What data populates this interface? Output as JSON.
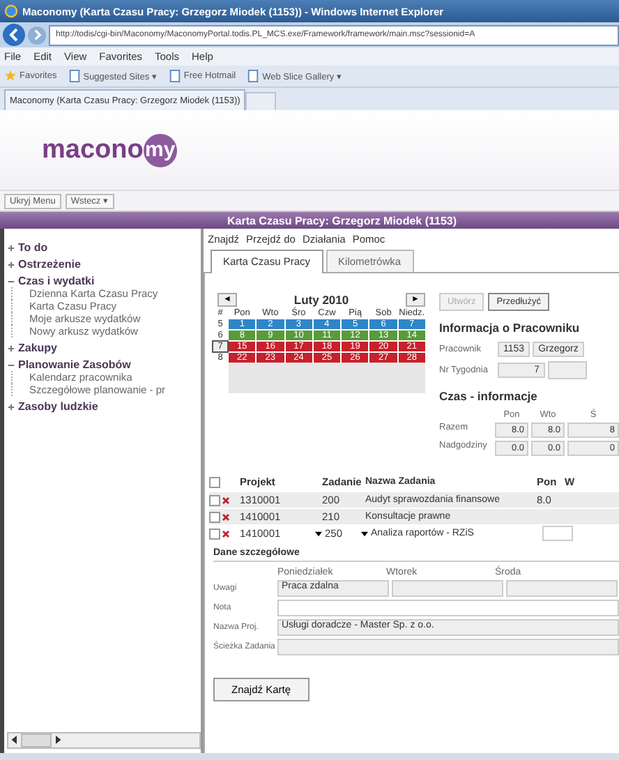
{
  "browser": {
    "title": "Maconomy (Karta Czasu Pracy: Grzegorz Miodek (1153)) - Windows Internet Explorer",
    "address": "http://todis/cgi-bin/Maconomy/MaconomyPortal.todis.PL_MCS.exe/Framework/framework/main.msc?sessionid=A",
    "menu": [
      "File",
      "Edit",
      "View",
      "Favorites",
      "Tools",
      "Help"
    ],
    "favorites": [
      {
        "label": "Favorites",
        "kind": "star"
      },
      {
        "label": "Suggested Sites ▾",
        "kind": "page"
      },
      {
        "label": "Free Hotmail",
        "kind": "page"
      },
      {
        "label": "Web Slice Gallery ▾",
        "kind": "page"
      }
    ],
    "tab": "Maconomy (Karta Czasu Pracy: Grzegorz Miodek (1153))"
  },
  "app": {
    "logo_text": "macono",
    "logo_badge": "my",
    "toolbar": [
      "Ukryj Menu",
      "Wstecz ▾"
    ]
  },
  "sidebar": {
    "items": [
      {
        "label": "To do",
        "expanded": false
      },
      {
        "label": "Ostrzeżenie",
        "expanded": false
      },
      {
        "label": "Czas i wydatki",
        "expanded": true,
        "children": [
          "Dzienna Karta Czasu Pracy",
          "Karta Czasu Pracy",
          "Moje arkusze wydatków",
          "Nowy arkusz wydatków"
        ]
      },
      {
        "label": "Zakupy",
        "expanded": false
      },
      {
        "label": "Planowanie Zasobów",
        "expanded": true,
        "children": [
          "Kalendarz pracownika",
          "Szczegółowe planowanie - pr"
        ]
      },
      {
        "label": "Zasoby ludzkie",
        "expanded": false
      }
    ]
  },
  "panel": {
    "title": "Karta Czasu Pracy: Grzegorz Miodek (1153)",
    "menu": [
      "Znajdź",
      "Przejdź do",
      "Działania",
      "Pomoc"
    ],
    "tabs": [
      {
        "label": "Karta Czasu Pracy",
        "selected": true
      },
      {
        "label": "Kilometrówka",
        "selected": false
      }
    ],
    "calendar": {
      "prev": "◄",
      "next": "►",
      "month": "Luty 2010",
      "headers": [
        "#",
        "Pon",
        "Wto",
        "Śro",
        "Czw",
        "Pią",
        "Sob",
        "Niedz."
      ],
      "weeks": [
        {
          "number": "5",
          "selected": false,
          "color": "#2e86c9",
          "days": [
            "1",
            "2",
            "3",
            "4",
            "5",
            "6",
            "7"
          ]
        },
        {
          "number": "6",
          "selected": false,
          "color": "#5a9a3a",
          "days": [
            "8",
            "9",
            "10",
            "11",
            "12",
            "13",
            "14"
          ]
        },
        {
          "number": "7",
          "selected": true,
          "color": "#c8202c",
          "days": [
            "15",
            "16",
            "17",
            "18",
            "19",
            "20",
            "21"
          ]
        },
        {
          "number": "8",
          "selected": false,
          "color": "#c8202c",
          "days": [
            "22",
            "23",
            "24",
            "25",
            "26",
            "27",
            "28"
          ]
        }
      ]
    },
    "actions": [
      {
        "label": "Utwórz",
        "disabled": true
      },
      {
        "label": "Przedłużyć",
        "disabled": false
      }
    ],
    "employee": {
      "title": "Informacja o Pracowniku",
      "employee_label": "Pracownik",
      "employee_id": "1153",
      "employee_name": "Grzegorz",
      "week_label": "Nr Tygodnia",
      "week_value": "7"
    },
    "time": {
      "title": "Czas - informacje",
      "columns": [
        "Pon",
        "Wto",
        "Ś"
      ],
      "rows": [
        {
          "label": "Razem",
          "values": [
            "8.0",
            "8.0",
            "8"
          ]
        },
        {
          "label": "Nadgodziny",
          "values": [
            "0.0",
            "0.0",
            "0"
          ]
        }
      ]
    },
    "table": {
      "all_checked": false,
      "columns": [
        "Projekt",
        "Zadanie",
        "Nazwa Zadania",
        "Pon",
        "W"
      ],
      "rows": [
        {
          "project": "1310001",
          "task": "200",
          "name": "Audyt sprawozdania finansowe",
          "pon": "8.0",
          "editing": false,
          "checked": false
        },
        {
          "project": "1410001",
          "task": "210",
          "name": "Konsultacje prawne",
          "editing": false,
          "checked": false
        },
        {
          "project": "1410001",
          "task": "250",
          "name": "Analiza raportów - RZiS",
          "editing": true,
          "checked": false
        }
      ]
    },
    "details": {
      "title": "Dane szczegółowe",
      "days": [
        "Poniedziałek",
        "Wtorek",
        "Środa"
      ],
      "notes_label": "Uwagi",
      "notes": [
        "Praca zdalna"
      ],
      "note_label": "Nota",
      "project_label": "Nazwa Proj.",
      "project_value": "Usługi doradcze - Master Sp. z o.o.",
      "path_label": "Ścieżka Zadania"
    },
    "find_button": "Znajdź Kartę"
  }
}
